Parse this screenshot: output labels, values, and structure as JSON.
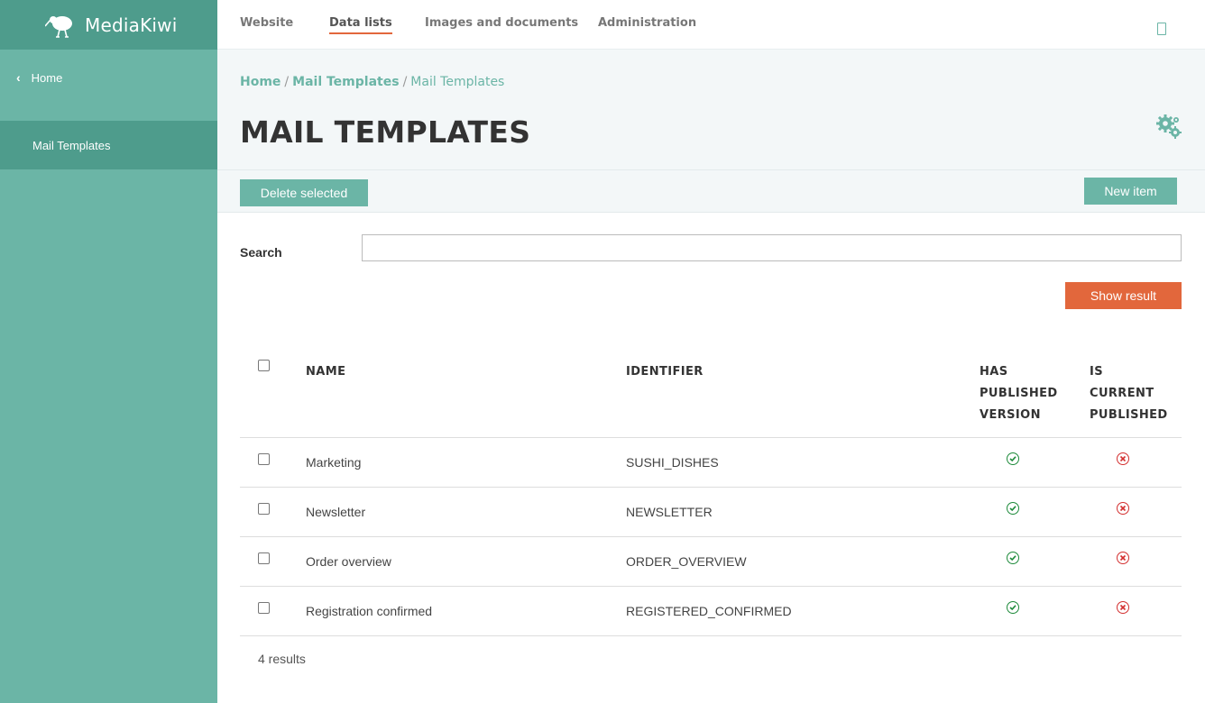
{
  "brand": {
    "name": "MediaKiwi"
  },
  "sidebar": {
    "home_label": "Home",
    "active_item": "Mail Templates"
  },
  "topnav": {
    "tabs": [
      {
        "label": "Website"
      },
      {
        "label": "Data lists"
      },
      {
        "label": "Images and documents"
      },
      {
        "label": "Administration"
      }
    ],
    "active_tab": "Data lists"
  },
  "breadcrumb": {
    "items": [
      "Home",
      "Mail Templates",
      "Mail Templates"
    ]
  },
  "page": {
    "title": "MAIL TEMPLATES"
  },
  "toolbar": {
    "delete_label": "Delete selected",
    "new_label": "New item"
  },
  "search": {
    "label": "Search",
    "value": "",
    "button_label": "Show result"
  },
  "table": {
    "columns": {
      "name": "NAME",
      "identifier": "IDENTIFIER",
      "has_published": [
        "HAS",
        "PUBLISHED",
        "VERSION"
      ],
      "is_current": [
        "IS",
        "CURRENT",
        "PUBLISHED"
      ]
    },
    "rows": [
      {
        "name": "Marketing",
        "identifier": "SUSHI_DISHES",
        "has_published": true,
        "is_current": false
      },
      {
        "name": "Newsletter",
        "identifier": "NEWSLETTER",
        "has_published": true,
        "is_current": false
      },
      {
        "name": "Order overview",
        "identifier": "ORDER_OVERVIEW",
        "has_published": true,
        "is_current": false
      },
      {
        "name": "Registration confirmed",
        "identifier": "REGISTERED_CONFIRMED",
        "has_published": true,
        "is_current": false
      }
    ],
    "results_text": "4 results"
  },
  "colors": {
    "sidebar": "#6bb5a6",
    "sidebar_dark": "#4e9c8c",
    "accent": "#e2673c",
    "ok": "#1d8a3a",
    "error": "#d32f2f"
  },
  "icons": [
    "kiwi-logo-icon",
    "chevron-left-icon",
    "mobile-icon",
    "gears-icon",
    "check-circle-icon",
    "x-circle-icon"
  ]
}
